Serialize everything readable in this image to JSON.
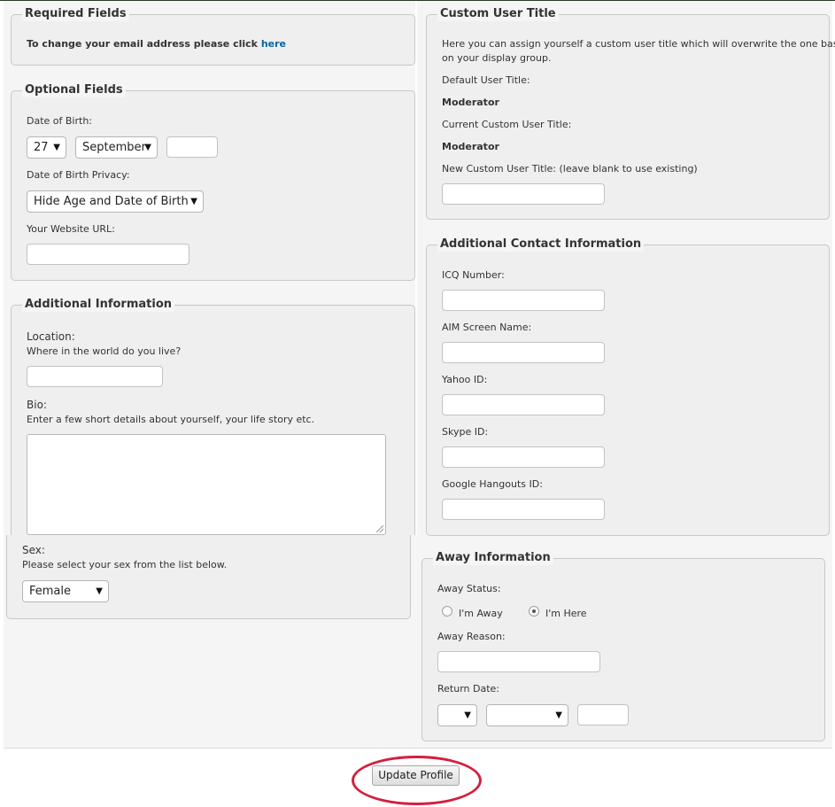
{
  "required_fields": {
    "legend": "Required Fields",
    "email_text": "To change your email address please click ",
    "email_link": "here"
  },
  "optional_fields": {
    "legend": "Optional Fields",
    "dob_label": "Date of Birth:",
    "dob_day": "27",
    "dob_month": "September",
    "dob_year": "",
    "privacy_label": "Date of Birth Privacy:",
    "privacy_value": "Hide Age and Date of Birth",
    "website_label": "Your Website URL:",
    "website_value": ""
  },
  "additional_info": {
    "legend": "Additional Information",
    "location_label": "Location:",
    "location_help": "Where in the world do you live?",
    "location_value": "",
    "bio_label": "Bio:",
    "bio_help": "Enter a few short details about yourself, your life story etc.",
    "bio_value": "",
    "sex_label": "Sex:",
    "sex_help": "Please select your sex from the list below.",
    "sex_value": "Female"
  },
  "custom_title": {
    "legend": "Custom User Title",
    "desc_line1": "Here you can assign yourself a custom user title which will overwrite the one based",
    "desc_line2": "on your display group.",
    "default_label": "Default User Title:",
    "default_value": "Moderator",
    "current_label": "Current Custom User Title:",
    "current_value": "Moderator",
    "new_label": "New Custom User Title: (leave blank to use existing)",
    "new_value": ""
  },
  "contact": {
    "legend": "Additional Contact Information",
    "icq_label": "ICQ Number:",
    "aim_label": "AIM Screen Name:",
    "yahoo_label": "Yahoo ID:",
    "skype_label": "Skype ID:",
    "hangouts_label": "Google Hangouts ID:"
  },
  "away": {
    "legend": "Away Information",
    "status_label": "Away Status:",
    "away_option": "I'm Away",
    "here_option": "I'm Here",
    "selected": "here",
    "reason_label": "Away Reason:",
    "reason_value": "",
    "return_label": "Return Date:",
    "return_day": "",
    "return_month": "",
    "return_year": ""
  },
  "actions": {
    "update_label": "Update Profile"
  },
  "colors": {
    "link": "#0a64a0",
    "highlight": "#d41f3f"
  }
}
